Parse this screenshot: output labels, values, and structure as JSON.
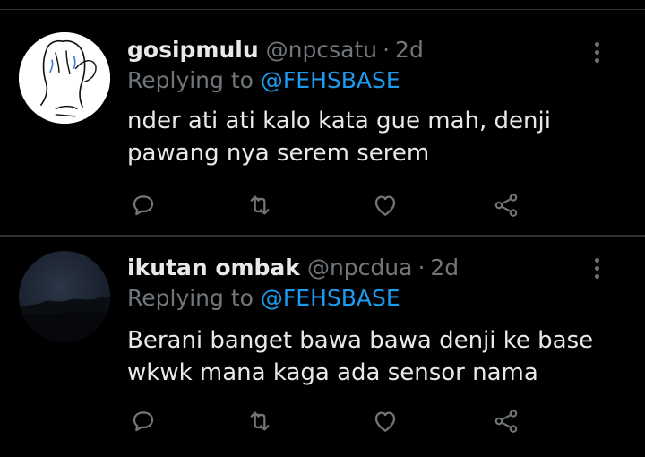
{
  "colors": {
    "background": "#000000",
    "divider": "#2f3336",
    "primary_text": "#e7e9ea",
    "secondary_text": "#71767b",
    "accent": "#1d9bf0"
  },
  "tweets": [
    {
      "display_name": "gosipmulu",
      "handle": "@npcsatu",
      "separator": "·",
      "time": "2d",
      "replying_prefix": "Replying to",
      "replying_to": "@FEHSBASE",
      "text_lines": [
        "nder ati ati kalo kata gue mah, denji",
        "pawang nya serem serem"
      ],
      "icons": [
        "reply-icon",
        "retweet-icon",
        "like-icon",
        "share-icon",
        "more-icon"
      ]
    },
    {
      "display_name": "ikutan ombak",
      "handle": "@npcdua",
      "separator": "·",
      "time": "2d",
      "replying_prefix": "Replying to",
      "replying_to": "@FEHSBASE",
      "text_lines": [
        "Berani banget bawa bawa denji ke base",
        "wkwk mana kaga ada sensor nama"
      ],
      "icons": [
        "reply-icon",
        "retweet-icon",
        "like-icon",
        "share-icon",
        "more-icon"
      ]
    }
  ]
}
